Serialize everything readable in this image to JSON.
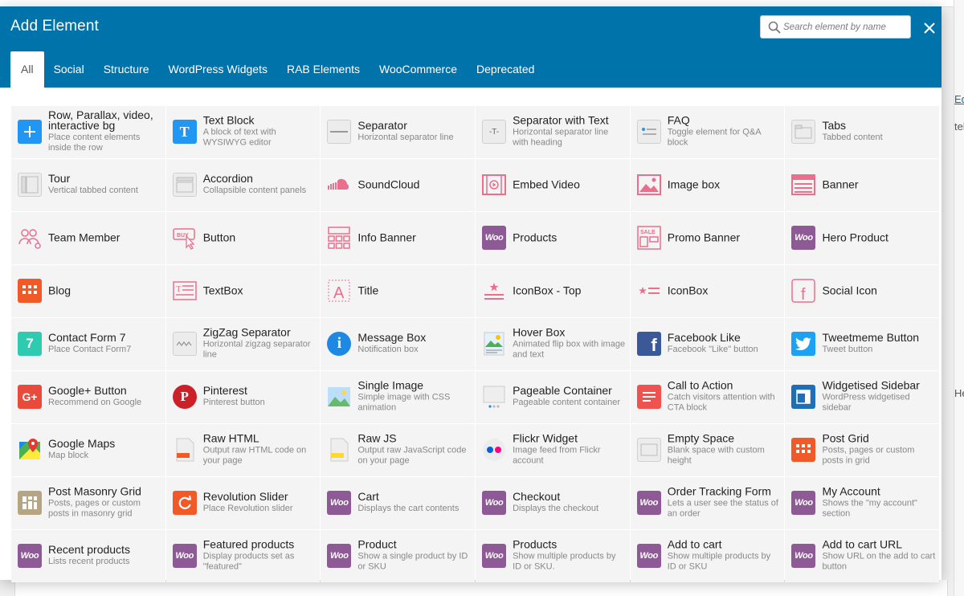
{
  "modal": {
    "title": "Add Element",
    "search_placeholder": "Search element by name"
  },
  "tabs": [
    "All",
    "Social",
    "Structure",
    "WordPress Widgets",
    "RAB Elements",
    "WooCommerce",
    "Deprecated"
  ],
  "background_fragments": [
    "Ed",
    "tel",
    "Hel"
  ],
  "colors": {
    "header": "#0073aa",
    "woo": "#8d5a95",
    "pink": "#e8708d",
    "blue": "#1e88e5",
    "orange": "#f05a28"
  },
  "elements": [
    {
      "name": "Row, Parallax, video, interactive bg",
      "desc": "Place content elements inside the row",
      "icon": "plus-icon"
    },
    {
      "name": "Text Block",
      "desc": "A block of text with WYSIWYG editor",
      "icon": "text-block-icon"
    },
    {
      "name": "Separator",
      "desc": "Horizontal separator line",
      "icon": "separator-icon"
    },
    {
      "name": "Separator with Text",
      "desc": "Horizontal separator line with heading",
      "icon": "separator-text-icon"
    },
    {
      "name": "FAQ",
      "desc": "Toggle element for Q&A block",
      "icon": "faq-icon"
    },
    {
      "name": "Tabs",
      "desc": "Tabbed content",
      "icon": "tabs-icon"
    },
    {
      "name": "Tour",
      "desc": "Vertical tabbed content",
      "icon": "tour-icon"
    },
    {
      "name": "Accordion",
      "desc": "Collapsible content panels",
      "icon": "accordion-icon"
    },
    {
      "name": "SoundCloud",
      "desc": "",
      "icon": "soundcloud-icon"
    },
    {
      "name": "Embed Video",
      "desc": "",
      "icon": "video-icon"
    },
    {
      "name": "Image box",
      "desc": "",
      "icon": "image-box-icon"
    },
    {
      "name": "Banner",
      "desc": "",
      "icon": "banner-icon"
    },
    {
      "name": "Team Member",
      "desc": "",
      "icon": "team-icon"
    },
    {
      "name": "Button",
      "desc": "",
      "icon": "buy-button-icon"
    },
    {
      "name": "Info Banner",
      "desc": "",
      "icon": "info-banner-icon"
    },
    {
      "name": "Products",
      "desc": "",
      "icon": "woo-icon",
      "woo_label": "Woo"
    },
    {
      "name": "Promo Banner",
      "desc": "",
      "icon": "sale-icon",
      "icon_label": "SALE"
    },
    {
      "name": "Hero Product",
      "desc": "",
      "icon": "woo-icon",
      "woo_label": "Woo"
    },
    {
      "name": "Blog",
      "desc": "",
      "icon": "blog-grid-icon"
    },
    {
      "name": "TextBox",
      "desc": "",
      "icon": "textbox-icon"
    },
    {
      "name": "Title",
      "desc": "",
      "icon": "title-icon",
      "icon_label": "A"
    },
    {
      "name": "IconBox - Top",
      "desc": "",
      "icon": "iconbox-top-icon"
    },
    {
      "name": "IconBox",
      "desc": "",
      "icon": "iconbox-icon"
    },
    {
      "name": "Social Icon",
      "desc": "",
      "icon": "facebook-outline-icon",
      "icon_label": "f"
    },
    {
      "name": "Contact Form 7",
      "desc": "Place Contact Form7",
      "icon": "contact-form-icon",
      "icon_label": "7"
    },
    {
      "name": "ZigZag Separator",
      "desc": "Horizontal zigzag separator line",
      "icon": "zigzag-icon"
    },
    {
      "name": "Message Box",
      "desc": "Notification box",
      "icon": "info-icon",
      "icon_label": "i"
    },
    {
      "name": "Hover Box",
      "desc": "Animated flip box with image and text",
      "icon": "hover-box-icon"
    },
    {
      "name": "Facebook Like",
      "desc": "Facebook \"Like\" button",
      "icon": "facebook-icon",
      "icon_label": "f"
    },
    {
      "name": "Tweetmeme Button",
      "desc": "Tweet button",
      "icon": "twitter-icon"
    },
    {
      "name": "Google+ Button",
      "desc": "Recommend on Google",
      "icon": "google-plus-icon",
      "icon_label": "G+"
    },
    {
      "name": "Pinterest",
      "desc": "Pinterest button",
      "icon": "pinterest-icon",
      "icon_label": "P"
    },
    {
      "name": "Single Image",
      "desc": "Simple image with CSS animation",
      "icon": "single-image-icon"
    },
    {
      "name": "Pageable Container",
      "desc": "Pageable content container",
      "icon": "pageable-icon"
    },
    {
      "name": "Call to Action",
      "desc": "Catch visitors attention with CTA block",
      "icon": "cta-icon"
    },
    {
      "name": "Widgetised Sidebar",
      "desc": "WordPress widgetised sidebar",
      "icon": "sidebar-icon"
    },
    {
      "name": "Google Maps",
      "desc": "Map block",
      "icon": "google-maps-icon"
    },
    {
      "name": "Raw HTML",
      "desc": "Output raw HTML code on your page",
      "icon": "raw-html-icon"
    },
    {
      "name": "Raw JS",
      "desc": "Output raw JavaScript code on your page",
      "icon": "raw-js-icon"
    },
    {
      "name": "Flickr Widget",
      "desc": "Image feed from Flickr account",
      "icon": "flickr-icon"
    },
    {
      "name": "Empty Space",
      "desc": "Blank space with custom height",
      "icon": "empty-space-icon"
    },
    {
      "name": "Post Grid",
      "desc": "Posts, pages or custom posts in grid",
      "icon": "post-grid-icon"
    },
    {
      "name": "Post Masonry Grid",
      "desc": "Posts, pages or custom posts in masonry grid",
      "icon": "masonry-grid-icon"
    },
    {
      "name": "Revolution Slider",
      "desc": "Place Revolution slider",
      "icon": "revolution-icon"
    },
    {
      "name": "Cart",
      "desc": "Displays the cart contents",
      "icon": "woo-icon",
      "woo_label": "Woo"
    },
    {
      "name": "Checkout",
      "desc": "Displays the checkout",
      "icon": "woo-icon",
      "woo_label": "Woo"
    },
    {
      "name": "Order Tracking Form",
      "desc": "Lets a user see the status of an order",
      "icon": "woo-icon",
      "woo_label": "Woo"
    },
    {
      "name": "My Account",
      "desc": "Shows the \"my account\" section",
      "icon": "woo-icon",
      "woo_label": "Woo"
    },
    {
      "name": "Recent products",
      "desc": "Lists recent products",
      "icon": "woo-icon",
      "woo_label": "Woo"
    },
    {
      "name": "Featured products",
      "desc": "Display products set as \"featured\"",
      "icon": "woo-icon",
      "woo_label": "Woo"
    },
    {
      "name": "Product",
      "desc": "Show a single product by ID or SKU",
      "icon": "woo-icon",
      "woo_label": "Woo"
    },
    {
      "name": "Products",
      "desc": "Show multiple products by ID or SKU.",
      "icon": "woo-icon",
      "woo_label": "Woo"
    },
    {
      "name": "Add to cart",
      "desc": "Show multiple products by ID or SKU",
      "icon": "woo-icon",
      "woo_label": "Woo"
    },
    {
      "name": "Add to cart URL",
      "desc": "Show URL on the add to cart button",
      "icon": "woo-icon",
      "woo_label": "Woo"
    }
  ]
}
